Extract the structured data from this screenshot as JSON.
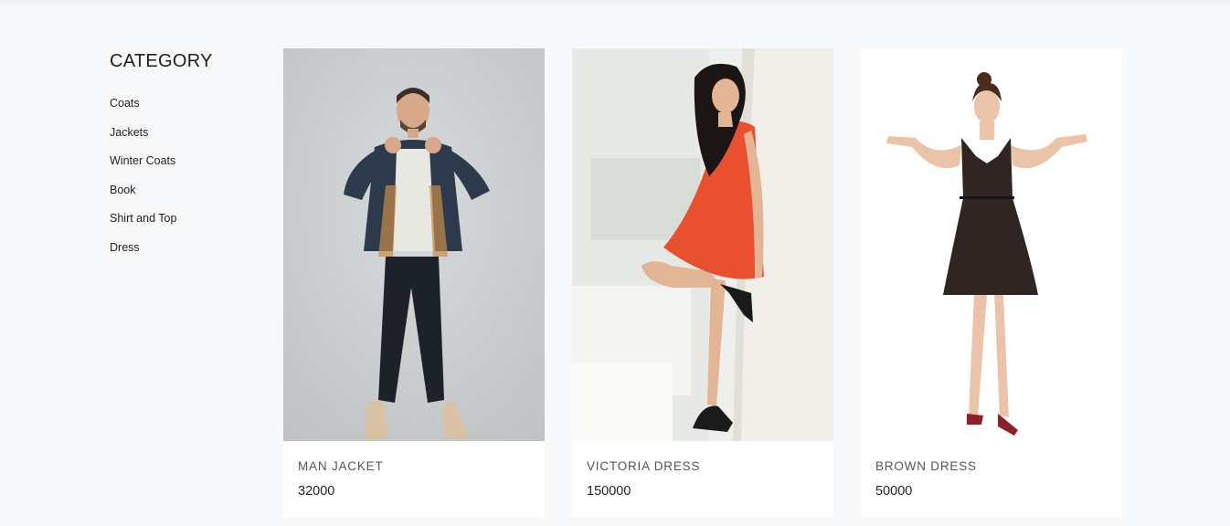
{
  "sidebar": {
    "heading": "CATEGORY",
    "items": [
      {
        "label": "Coats"
      },
      {
        "label": "Jackets"
      },
      {
        "label": "Winter Coats"
      },
      {
        "label": "Book"
      },
      {
        "label": "Shirt and Top"
      },
      {
        "label": "Dress"
      }
    ]
  },
  "products": [
    {
      "name": "MAN JACKET",
      "price": "32000",
      "image": "man-in-denim-jacket-photo"
    },
    {
      "name": "VICTORIA DRESS",
      "price": "150000",
      "image": "woman-in-red-dress-photo"
    },
    {
      "name": "BROWN DRESS",
      "price": "50000",
      "image": "woman-in-brown-dress-photo"
    }
  ],
  "colors": {
    "page_background": "#f7f8fa",
    "card_background": "#ffffff",
    "red_dress": "#e8502f",
    "brown_dress": "#2f2522",
    "denim": "#2c3a4c"
  }
}
